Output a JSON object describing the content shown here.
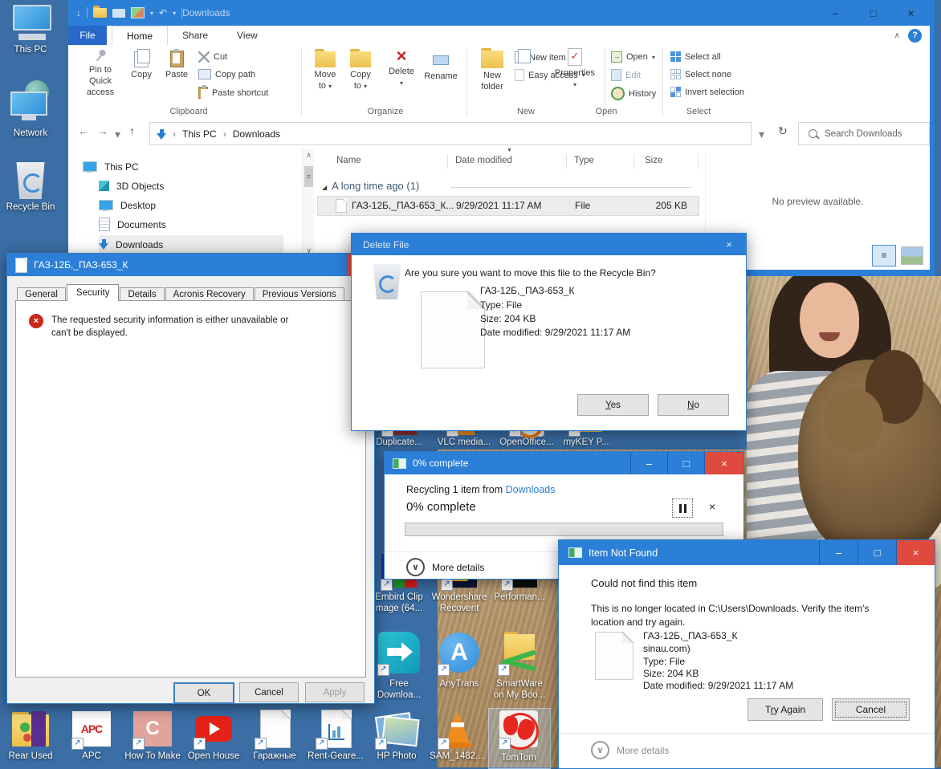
{
  "icons": {
    "minimize": "–",
    "maximize": "□",
    "close": "×",
    "help": "?",
    "back": "←",
    "forward": "→",
    "up": "↑",
    "refresh": "↻",
    "caret": "▾",
    "dropdown": "∨",
    "crumb": "›",
    "sort": "▼",
    "group": "◢",
    "scroll_up": "∧",
    "scroll_down": "∨",
    "grip": "≡",
    "qat_down": "↓",
    "undo": "↶",
    "check": "✓"
  },
  "desktop": {
    "left_icons": [
      "This PC",
      "Network",
      "Recycle Bin"
    ],
    "row1": [
      "Duplicate...",
      "VLC media...",
      "OpenOffice...",
      "myKEY P..."
    ],
    "row2": [
      {
        "l1": "Embird Clip",
        "l2": "mage (64..."
      },
      {
        "l1": "Wondershare",
        "l2": "Recoverit"
      },
      {
        "l1": "Performan...",
        "l2": ""
      }
    ],
    "row3": [
      {
        "l1": "Free",
        "l2": "Downloa..."
      },
      {
        "l1": "AnyTrans",
        "l2": ""
      },
      {
        "l1": "SmartWare",
        "l2": "on My Boo..."
      }
    ],
    "bottom": [
      "Rear Used",
      "APC",
      "How To Make",
      "Open House",
      "Гаражные",
      "Rent-Geare...",
      "HP Photo",
      "SAM_1482....",
      "TomTom"
    ],
    "glyph_apc": "APC",
    "glyph_c": "C",
    "glyph_a": "A"
  },
  "explorer": {
    "title": "Downloads",
    "tabs": {
      "file": "File",
      "home": "Home",
      "share": "Share",
      "view": "View"
    },
    "ribbon": {
      "pin1": "Pin to Quick",
      "pin2": "access",
      "copy": "Copy",
      "paste": "Paste",
      "cut": "Cut",
      "copy_path": "Copy path",
      "paste_shortcut": "Paste shortcut",
      "move1": "Move",
      "move2": "to",
      "copyto1": "Copy",
      "copyto2": "to",
      "del": "Delete",
      "rename": "Rename",
      "newfolder1": "New",
      "newfolder2": "folder",
      "new_item": "New item",
      "easy_access": "Easy access",
      "properties": "Properties",
      "open": "Open",
      "edit": "Edit",
      "history": "History",
      "select_all": "Select all",
      "select_none": "Select none",
      "invert": "Invert selection",
      "g_clip": "Clipboard",
      "g_org": "Organize",
      "g_new": "New",
      "g_open": "Open",
      "g_sel": "Select"
    },
    "address": {
      "c1": "This PC",
      "c2": "Downloads",
      "search": "Search Downloads"
    },
    "tree": [
      "This PC",
      "3D Objects",
      "Desktop",
      "Documents",
      "Downloads"
    ],
    "list": {
      "col_name": "Name",
      "col_date": "Date modified",
      "col_type": "Type",
      "col_size": "Size",
      "group": "A long time ago (1)",
      "row": {
        "name": "ГАЗ-12Б,_ПАЗ-653_К...",
        "date": "9/29/2021 11:17 AM",
        "type": "File",
        "size": "205 KB"
      }
    },
    "preview": "No preview available."
  },
  "properties": {
    "title": "ГАЗ-12Б,_ПАЗ-653_К",
    "tabs": [
      "General",
      "Security",
      "Details",
      "Acronis Recovery",
      "Previous Versions"
    ],
    "error": "The requested security information is either unavailable or can't be displayed.",
    "ok": "OK",
    "cancel": "Cancel",
    "apply": "Apply"
  },
  "delete_dialog": {
    "title": "Delete File",
    "question": "Are you sure you want to move this file to the Recycle Bin?",
    "name": "ГАЗ-12Б,_ПАЗ-653_К",
    "type": "Type: File",
    "size": "Size: 204 KB",
    "modified": "Date modified: 9/29/2021 11:17 AM",
    "yes_mn": "Y",
    "yes_rest": "es",
    "no_mn": "N",
    "no_rest": "o"
  },
  "progress": {
    "title": "0% complete",
    "line_prefix": "Recycling 1 item from ",
    "link": "Downloads",
    "percent": "0% complete",
    "more": "More details"
  },
  "notfound": {
    "title": "Item Not Found",
    "heading": "Could not find this item",
    "body1": "This is no longer located in C:\\Users\\Downloads. Verify the item's",
    "body2": "location and try again.",
    "name": "ГАЗ-12Б,_ПАЗ-653_К",
    "extra": "sinau.com)",
    "type": "Type: File",
    "size": "Size: 204 KB",
    "modified": "Date modified: 9/29/2021 11:17 AM",
    "try_pre": "T",
    "try_mn": "r",
    "try_rest": "y Again",
    "cancel": "Cancel",
    "more": "More details"
  }
}
